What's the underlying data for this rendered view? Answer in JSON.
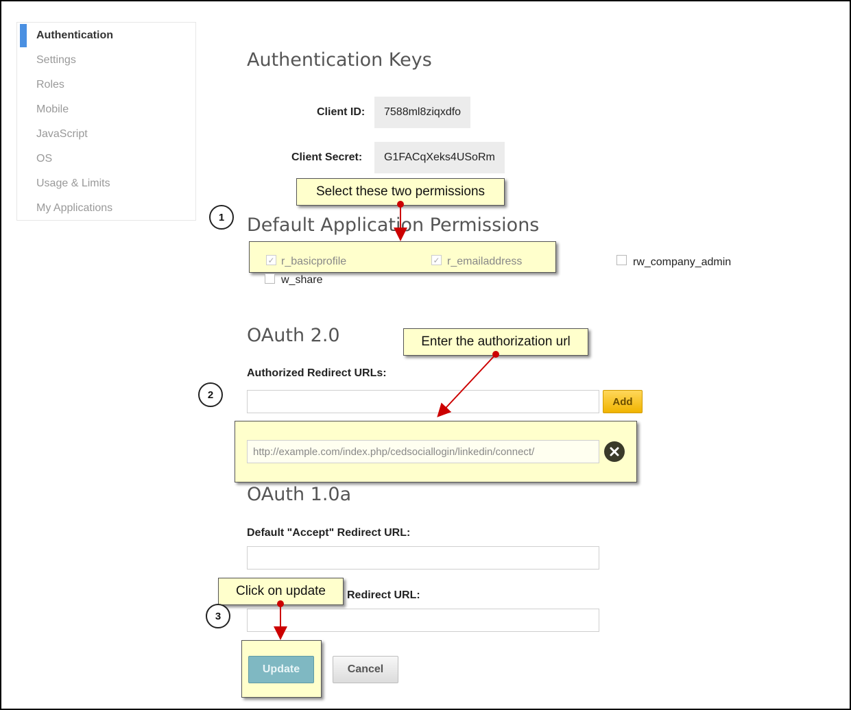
{
  "sidebar": {
    "items": [
      {
        "label": "Authentication",
        "active": true
      },
      {
        "label": "Settings"
      },
      {
        "label": "Roles"
      },
      {
        "label": "Mobile"
      },
      {
        "label": "JavaScript"
      },
      {
        "label": "OS"
      },
      {
        "label": "Usage & Limits"
      },
      {
        "label": "My Applications"
      }
    ]
  },
  "auth_keys": {
    "title": "Authentication Keys",
    "client_id_label": "Client ID:",
    "client_id_value": "7588ml8ziqxdfo",
    "client_secret_label": "Client Secret:",
    "client_secret_value": "G1FACqXeks4USoRm"
  },
  "permissions": {
    "title": "Default Application Permissions",
    "items": [
      {
        "label": "r_basicprofile",
        "checked": true
      },
      {
        "label": "r_emailaddress",
        "checked": true
      },
      {
        "label": "rw_company_admin",
        "checked": false
      },
      {
        "label": "w_share",
        "checked": false
      }
    ]
  },
  "oauth2": {
    "title": "OAuth 2.0",
    "redirect_label": "Authorized Redirect URLs:",
    "redirect_input_value": "",
    "add_label": "Add",
    "saved_url": "http://example.com/index.php/cedsociallogin/linkedin/connect/"
  },
  "oauth1": {
    "title": "OAuth 1.0a",
    "accept_label": "Default \"Accept\" Redirect URL:",
    "accept_value": "",
    "cancel_redirect_label": "Redirect URL:",
    "cancel_redirect_value": ""
  },
  "actions": {
    "update_label": "Update",
    "cancel_label": "Cancel"
  },
  "annotations": {
    "callout_1": "Select these two permissions",
    "callout_2": "Enter the authorization url",
    "callout_3": "Click on update",
    "step_1": "1",
    "step_2": "2",
    "step_3": "3",
    "arrow_color": "#cc0000"
  },
  "icons": {
    "remove": "close-circle-icon",
    "checkbox_checked": "check-icon"
  }
}
